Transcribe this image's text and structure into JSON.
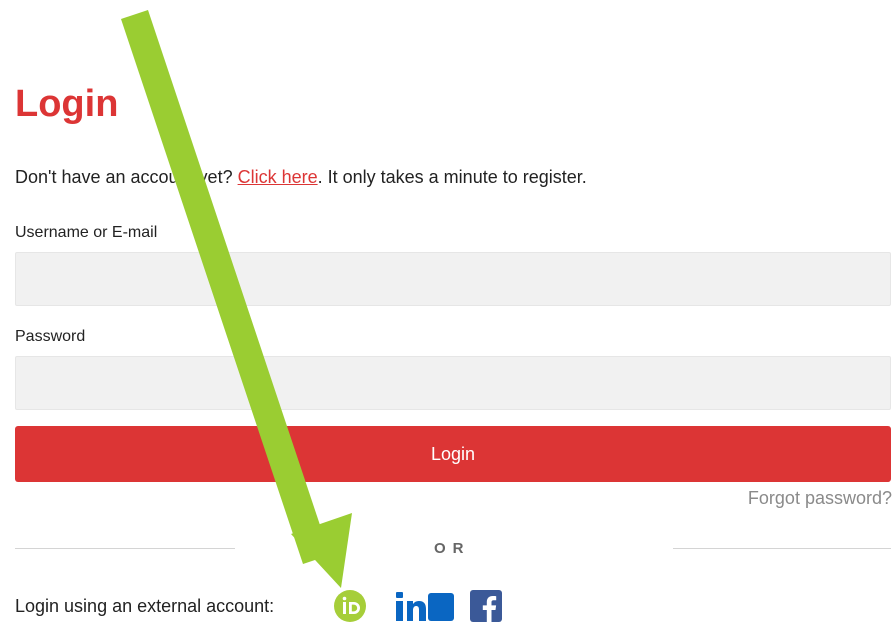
{
  "login": {
    "title": "Login",
    "intro_prefix": "Don't have an account yet? ",
    "register_link": "Click here",
    "intro_suffix": ". It only takes a minute to register.",
    "username_label": "Username or E-mail",
    "username_value": "",
    "password_label": "Password",
    "password_value": "",
    "submit_label": "Login",
    "forgot_link": "Forgot password?",
    "or_text": "OR",
    "external_label": "Login using an external account:"
  },
  "icons": {
    "orcid": "orcid-icon",
    "linkedin": "linkedin-icon",
    "facebook": "facebook-icon",
    "arrow": "green-arrow-annotation"
  },
  "colors": {
    "accent": "#dc3535",
    "arrow": "#9acd32",
    "orcid": "#a6ce39",
    "linkedin": "#0a66c2",
    "facebook": "#3b5998"
  }
}
